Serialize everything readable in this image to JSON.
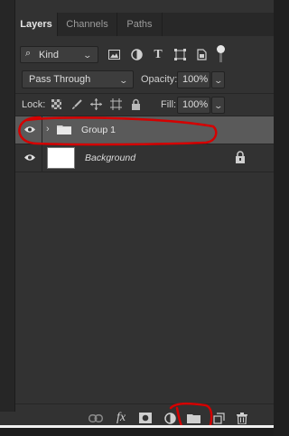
{
  "tabs": [
    "Layers",
    "Channels",
    "Paths"
  ],
  "filter": {
    "kind_label": "Kind",
    "icons": [
      "image-filter-icon",
      "adjustment-filter-icon",
      "type-filter-icon",
      "shape-filter-icon",
      "smart-object-filter-icon",
      "filter-toggle-icon"
    ]
  },
  "blend": {
    "mode": "Pass Through",
    "opacity_label": "Opacity:",
    "opacity_value": "100%",
    "fill_label": "Fill:",
    "fill_value": "100%"
  },
  "lock": {
    "label": "Lock:",
    "icons": [
      "lock-transparent-pixels-icon",
      "lock-image-pixels-icon",
      "lock-position-icon",
      "lock-artboard-icon",
      "lock-all-icon"
    ]
  },
  "layers": [
    {
      "name": "Group 1",
      "type": "group",
      "visible": true,
      "selected": true
    },
    {
      "name": "Background",
      "type": "pixel",
      "visible": true,
      "locked": true,
      "selected": false
    }
  ],
  "bottom_toolbar": [
    "link-layers-icon",
    "fx-icon",
    "mask-icon",
    "adjustment-layer-icon",
    "new-group-icon",
    "new-layer-icon",
    "delete-icon"
  ],
  "fx_text": "fx",
  "colors": {
    "panel_bg": "#323232",
    "selected_row": "#5a5a5a",
    "annotation_red": "#d40000"
  }
}
